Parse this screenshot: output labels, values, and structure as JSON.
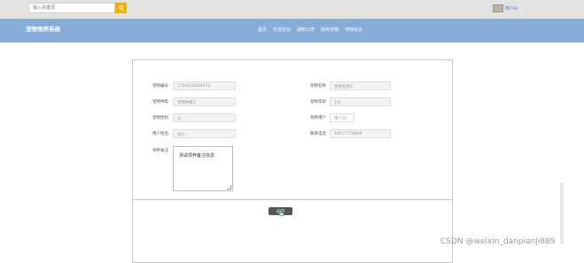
{
  "search": {
    "placeholder": "输入关键词"
  },
  "user": {
    "name": "用户01"
  },
  "site": {
    "title": "宠物领养系统"
  },
  "nav": {
    "items": [
      "首页",
      "交流论坛",
      "通知公告",
      "领养宠物",
      "宠物信息"
    ]
  },
  "form": {
    "fields": [
      {
        "label": "宠物编号",
        "value": "1704233584473"
      },
      {
        "label": "宠物名称",
        "value": "宠物名称1"
      },
      {
        "label": "宠物种类",
        "value": "宠物种类1"
      },
      {
        "label": "宠物年龄",
        "value": "1岁"
      },
      {
        "label": "宠物性别",
        "value": "公"
      },
      {
        "label": "领养用户",
        "value": "用户01"
      },
      {
        "label": "用户姓名",
        "value": "张三"
      },
      {
        "label": "联系电话",
        "value": "18077778888"
      }
    ],
    "remark_label": "领养备注",
    "remark_value": "测试领养备注信息"
  },
  "actions": {
    "back_label": "返回"
  },
  "watermark": "CSDN @weixin_danpianji889"
}
